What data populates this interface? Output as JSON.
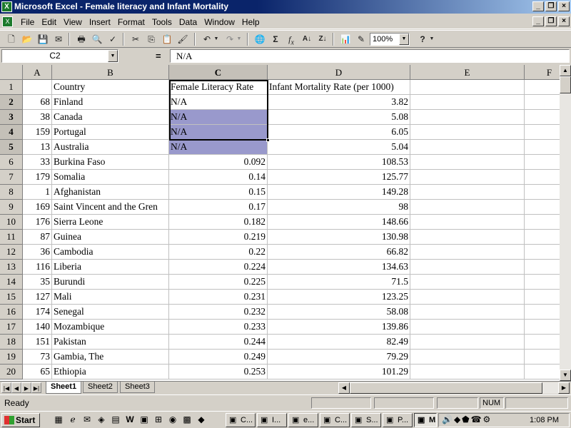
{
  "window": {
    "title": "Microsoft Excel - Female literacy and Infant Mortality"
  },
  "menu": [
    "File",
    "Edit",
    "View",
    "Insert",
    "Format",
    "Tools",
    "Data",
    "Window",
    "Help"
  ],
  "toolbar": {
    "zoom": "100%"
  },
  "formula_bar": {
    "name_box": "C2",
    "equals": "=",
    "content": "N/A"
  },
  "columns": [
    "A",
    "B",
    "C",
    "D",
    "E",
    "F"
  ],
  "selected_column": "C",
  "rows": [
    {
      "n": "1",
      "a": "",
      "b": "Country",
      "c": "Female Literacy Rate",
      "d": "Infant Mortality Rate (per 1000)"
    },
    {
      "n": "2",
      "a": "68",
      "b": "Finland",
      "c": "N/A",
      "d": "3.82"
    },
    {
      "n": "3",
      "a": "38",
      "b": "Canada",
      "c": "N/A",
      "d": "5.08"
    },
    {
      "n": "4",
      "a": "159",
      "b": "Portugal",
      "c": "N/A",
      "d": "6.05"
    },
    {
      "n": "5",
      "a": "13",
      "b": "Australia",
      "c": "N/A",
      "d": "5.04"
    },
    {
      "n": "6",
      "a": "33",
      "b": "Burkina Faso",
      "c": "0.092",
      "d": "108.53"
    },
    {
      "n": "7",
      "a": "179",
      "b": "Somalia",
      "c": "0.14",
      "d": "125.77"
    },
    {
      "n": "8",
      "a": "1",
      "b": "Afghanistan",
      "c": "0.15",
      "d": "149.28"
    },
    {
      "n": "9",
      "a": "169",
      "b": "Saint Vincent and the Gren",
      "c": "0.17",
      "d": "98"
    },
    {
      "n": "10",
      "a": "176",
      "b": "Sierra Leone",
      "c": "0.182",
      "d": "148.66"
    },
    {
      "n": "11",
      "a": "87",
      "b": "Guinea",
      "c": "0.219",
      "d": "130.98"
    },
    {
      "n": "12",
      "a": "36",
      "b": "Cambodia",
      "c": "0.22",
      "d": "66.82"
    },
    {
      "n": "13",
      "a": "116",
      "b": "Liberia",
      "c": "0.224",
      "d": "134.63"
    },
    {
      "n": "14",
      "a": "35",
      "b": "Burundi",
      "c": "0.225",
      "d": "71.5"
    },
    {
      "n": "15",
      "a": "127",
      "b": "Mali",
      "c": "0.231",
      "d": "123.25"
    },
    {
      "n": "16",
      "a": "174",
      "b": "Senegal",
      "c": "0.232",
      "d": "58.08"
    },
    {
      "n": "17",
      "a": "140",
      "b": "Mozambique",
      "c": "0.233",
      "d": "139.86"
    },
    {
      "n": "18",
      "a": "151",
      "b": "Pakistan",
      "c": "0.244",
      "d": "82.49"
    },
    {
      "n": "19",
      "a": "73",
      "b": "Gambia, The",
      "c": "0.249",
      "d": "79.29"
    },
    {
      "n": "20",
      "a": "65",
      "b": "Ethiopia",
      "c": "0.253",
      "d": "101.29"
    }
  ],
  "sheets": [
    "Sheet1",
    "Sheet2",
    "Sheet3"
  ],
  "active_sheet": "Sheet1",
  "status": {
    "text": "Ready",
    "num": "NUM"
  },
  "taskbar": {
    "start": "Start",
    "tasks": [
      "C...",
      "I...",
      "e...",
      "C...",
      "S...",
      "P...",
      "M..."
    ],
    "active_task": "M...",
    "clock": "1:08 PM"
  },
  "colors": {
    "title_bar": "#0a246a",
    "selection_fill": "#9999cc",
    "chrome": "#d4d0c8"
  }
}
